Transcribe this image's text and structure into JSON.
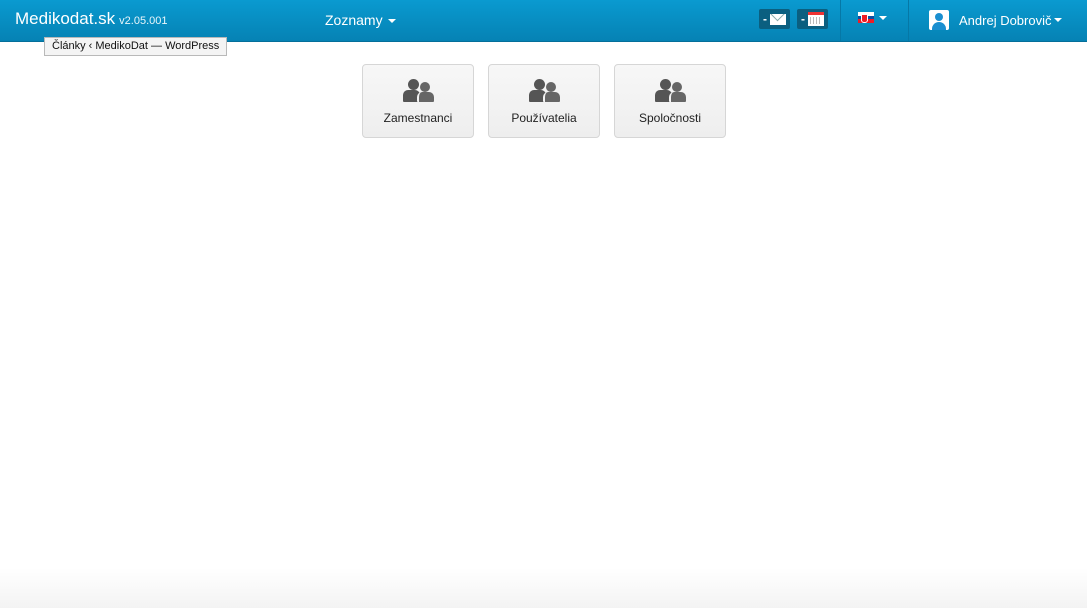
{
  "navbar": {
    "brand": "Medikodat.sk",
    "version": "v2.05.001",
    "menu_lists": "Zoznamy",
    "messages_count": "-",
    "events_count": "-",
    "language_flag": "slovak-flag-icon",
    "user_name": "Andrej Dobrovič"
  },
  "tooltip": "Články ‹ MedikoDat — WordPress",
  "tiles": [
    {
      "label": "Zamestnanci",
      "icon": "users-icon"
    },
    {
      "label": "Používatelia",
      "icon": "users-icon"
    },
    {
      "label": "Spoločnosti",
      "icon": "users-icon"
    }
  ],
  "colors": {
    "navbar": "#0a9ad0",
    "tile_bg": "#f2f2f2",
    "icon": "#555555"
  }
}
